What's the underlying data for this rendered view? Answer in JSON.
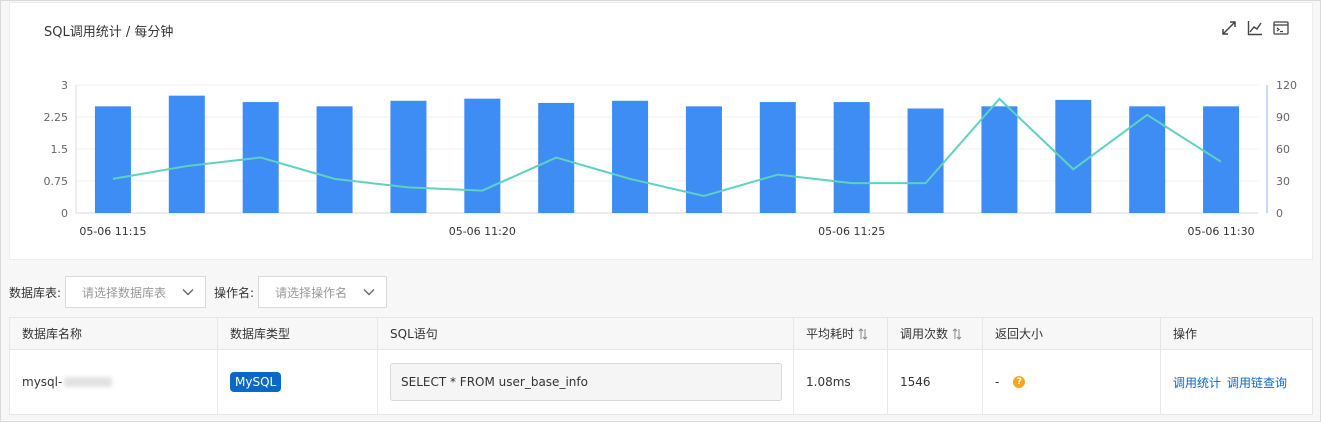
{
  "chart": {
    "title": "SQL调用统计 / 每分钟",
    "tools": [
      {
        "name": "expand-icon"
      },
      {
        "name": "line-chart-icon"
      },
      {
        "name": "terminal-icon"
      }
    ]
  },
  "chart_data": {
    "type": "bar",
    "title": "SQL调用统计 / 每分钟",
    "categories": [
      "05-06 11:15",
      "05-06 11:16",
      "05-06 11:17",
      "05-06 11:18",
      "05-06 11:19",
      "05-06 11:20",
      "05-06 11:21",
      "05-06 11:22",
      "05-06 11:23",
      "05-06 11:24",
      "05-06 11:25",
      "05-06 11:26",
      "05-06 11:27",
      "05-06 11:28",
      "05-06 11:29",
      "05-06 11:30"
    ],
    "x_tick_labels": [
      "05-06 11:15",
      "05-06 11:20",
      "05-06 11:25",
      "05-06 11:30"
    ],
    "y_left_ticks": [
      "0",
      "0.75",
      "1.5",
      "2.25",
      "3"
    ],
    "y_right_ticks": [
      "0",
      "30",
      "60",
      "90",
      "120"
    ],
    "ylim_left": [
      0,
      3
    ],
    "ylim_right": [
      0,
      120
    ],
    "series": [
      {
        "type": "bar",
        "axis": "left",
        "color": "#3d8df5",
        "values": [
          2.5,
          2.75,
          2.6,
          2.5,
          2.63,
          2.68,
          2.58,
          2.63,
          2.5,
          2.6,
          2.6,
          2.45,
          2.5,
          2.65,
          2.5,
          2.5
        ]
      },
      {
        "type": "line",
        "axis": "right",
        "color": "#5fd1c0",
        "values": [
          32,
          44,
          52,
          32,
          24,
          21,
          52,
          32,
          16,
          36,
          28,
          28,
          107,
          41,
          92,
          48
        ]
      }
    ],
    "grid": true
  },
  "filters": {
    "db_label": "数据库表:",
    "db_placeholder": "请选择数据库表",
    "op_label": "操作名:",
    "op_placeholder": "请选择操作名"
  },
  "table": {
    "headers": [
      "数据库名称",
      "数据库类型",
      "SQL语句",
      "平均耗时",
      "调用次数",
      "返回大小",
      "操作"
    ],
    "rows": [
      {
        "db_name": "mysql-",
        "db_type": "MySQL",
        "sql": "SELECT * FROM user_base_info",
        "avg_time": "1.08ms",
        "calls": "1546",
        "size": "-",
        "actions": [
          "调用统计",
          "调用链查询"
        ]
      }
    ]
  },
  "colors": {
    "bar": "#3d8df5",
    "line": "#5fd1c0",
    "badge": "#0a68c7",
    "link": "#0a68c7",
    "help": "#f5a623"
  }
}
